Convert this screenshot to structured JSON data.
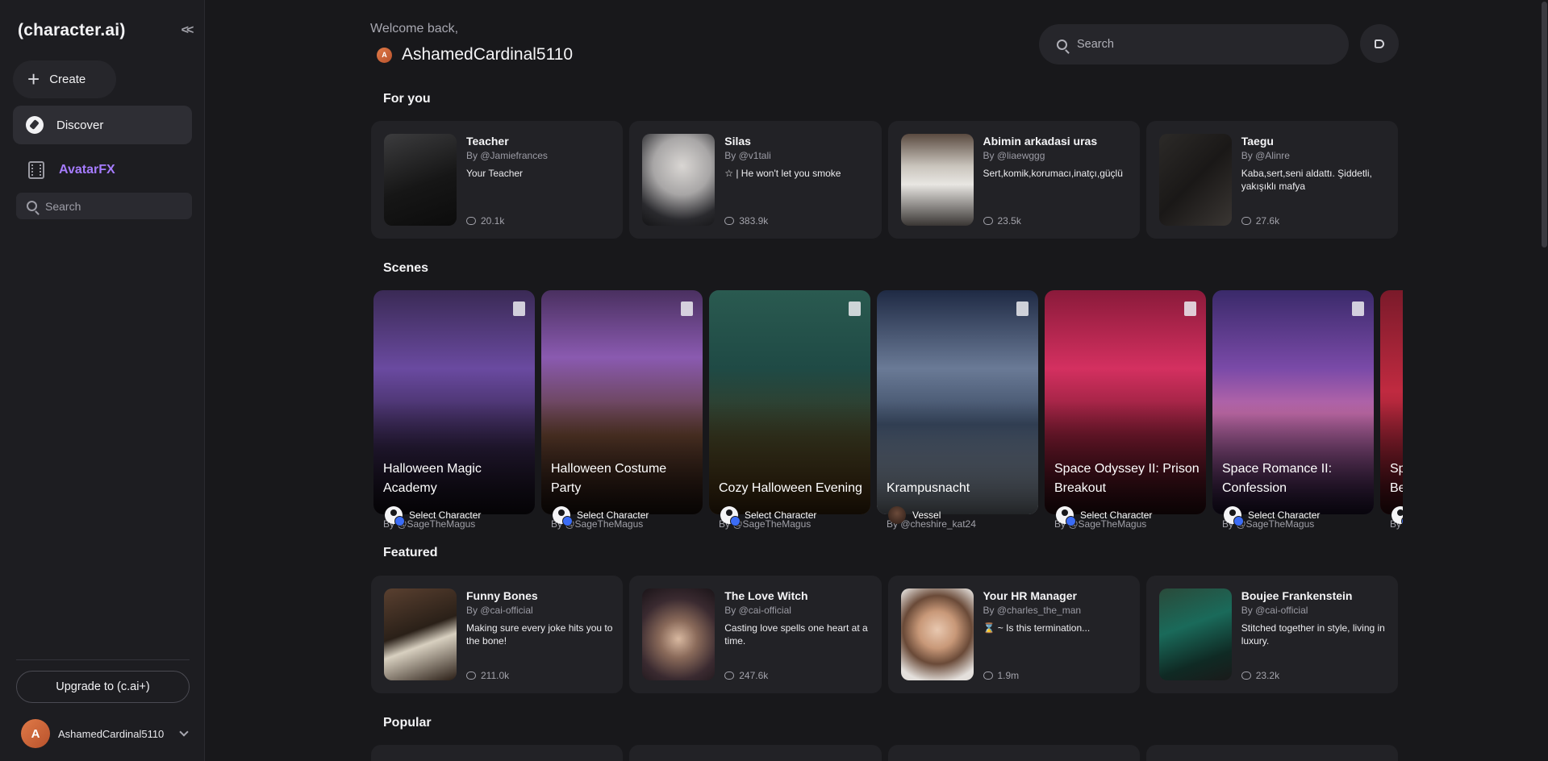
{
  "sidebar": {
    "logo": "(character.ai)",
    "collapse_icon": "<<",
    "create_label": "Create",
    "discover_label": "Discover",
    "avatarfx_label": "AvatarFX",
    "search_placeholder": "Search",
    "upgrade_label": "Upgrade to (c.ai+)",
    "user_initial": "A",
    "username": "AshamedCardinal5110"
  },
  "header": {
    "welcome": "Welcome back,",
    "user_initial": "A",
    "username": "AshamedCardinal5110",
    "search_placeholder": "Search"
  },
  "sections": {
    "for_you": "For you",
    "scenes": "Scenes",
    "featured": "Featured",
    "popular": "Popular"
  },
  "for_you": [
    {
      "name": "Teacher",
      "by": "By @Jamiefrances",
      "desc": "Your Teacher",
      "chats": "20.1k"
    },
    {
      "name": "Silas",
      "by": "By @v1tali",
      "desc": "☆ | He won't let you smoke",
      "chats": "383.9k"
    },
    {
      "name": "Abimin arkadasi uras",
      "by": "By @liaewggg",
      "desc": "Sert,komik,korumacı,inatçı,güçlü",
      "chats": "23.5k"
    },
    {
      "name": "Taegu",
      "by": "By @Alinre",
      "desc": "Kaba,sert,seni aldattı. Şiddetli, yakışıklı mafya",
      "chats": "27.6k"
    }
  ],
  "scenes": [
    {
      "title": "Halloween Magic Academy",
      "char": "Select Character",
      "by": "By @SageTheMagus"
    },
    {
      "title": "Halloween Costume Party",
      "char": "Select Character",
      "by": "By @SageTheMagus"
    },
    {
      "title": "Cozy Halloween Evening",
      "char": "Select Character",
      "by": "By @SageTheMagus"
    },
    {
      "title": "Krampusnacht",
      "char": "Vessel",
      "by": "By @cheshire_kat24"
    },
    {
      "title": "Space Odyssey II: Prison Breakout",
      "char": "Select Character",
      "by": "By @SageTheMagus"
    },
    {
      "title": "Space Romance II: Confession",
      "char": "Select Character",
      "by": "By @SageTheMagus"
    },
    {
      "title": "Sp Be",
      "char": "",
      "by": "By"
    }
  ],
  "featured": [
    {
      "name": "Funny Bones",
      "by": "By @cai-official",
      "desc": "Making sure every joke hits you to the bone!",
      "chats": "211.0k"
    },
    {
      "name": "The Love Witch",
      "by": "By @cai-official",
      "desc": "Casting love spells one heart at a time.",
      "chats": "247.6k"
    },
    {
      "name": "Your HR Manager",
      "by": "By @charles_the_man",
      "desc": "⌛ ~ Is this termination...",
      "chats": "1.9m"
    },
    {
      "name": "Boujee Frankenstein",
      "by": "By @cai-official",
      "desc": "Stitched together in style, living in luxury.",
      "chats": "23.2k"
    }
  ],
  "colors": {
    "accent_purple": "#a67cff",
    "background": "#18181b",
    "card": "#222226"
  }
}
